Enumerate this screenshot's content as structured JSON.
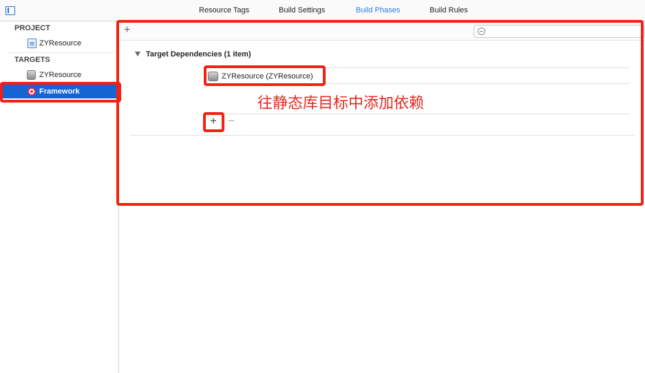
{
  "tabs": [
    {
      "label": "Resource Tags"
    },
    {
      "label": "Build Settings"
    },
    {
      "label": "Build Phases"
    },
    {
      "label": "Build Rules"
    }
  ],
  "active_tab": "Build Phases",
  "sidebar": {
    "project_header": "PROJECT",
    "project_item": "ZYResource",
    "targets_header": "TARGETS",
    "targets": [
      {
        "label": "ZYResource"
      },
      {
        "label": "Framework"
      }
    ]
  },
  "main": {
    "add_phase_icon": "plus-icon",
    "filter_icon": "search-icon",
    "phase_title": "Target Dependencies (1 item)",
    "dependency": "ZYResource (ZYResource)",
    "add_label": "+",
    "remove_label": "−"
  },
  "annotation": "往静态库目标中添加依赖",
  "colors": {
    "accent": "#2a7be4",
    "selection": "#1464d4",
    "highlight": "#f51f12",
    "annotation_text": "#e5281e"
  }
}
